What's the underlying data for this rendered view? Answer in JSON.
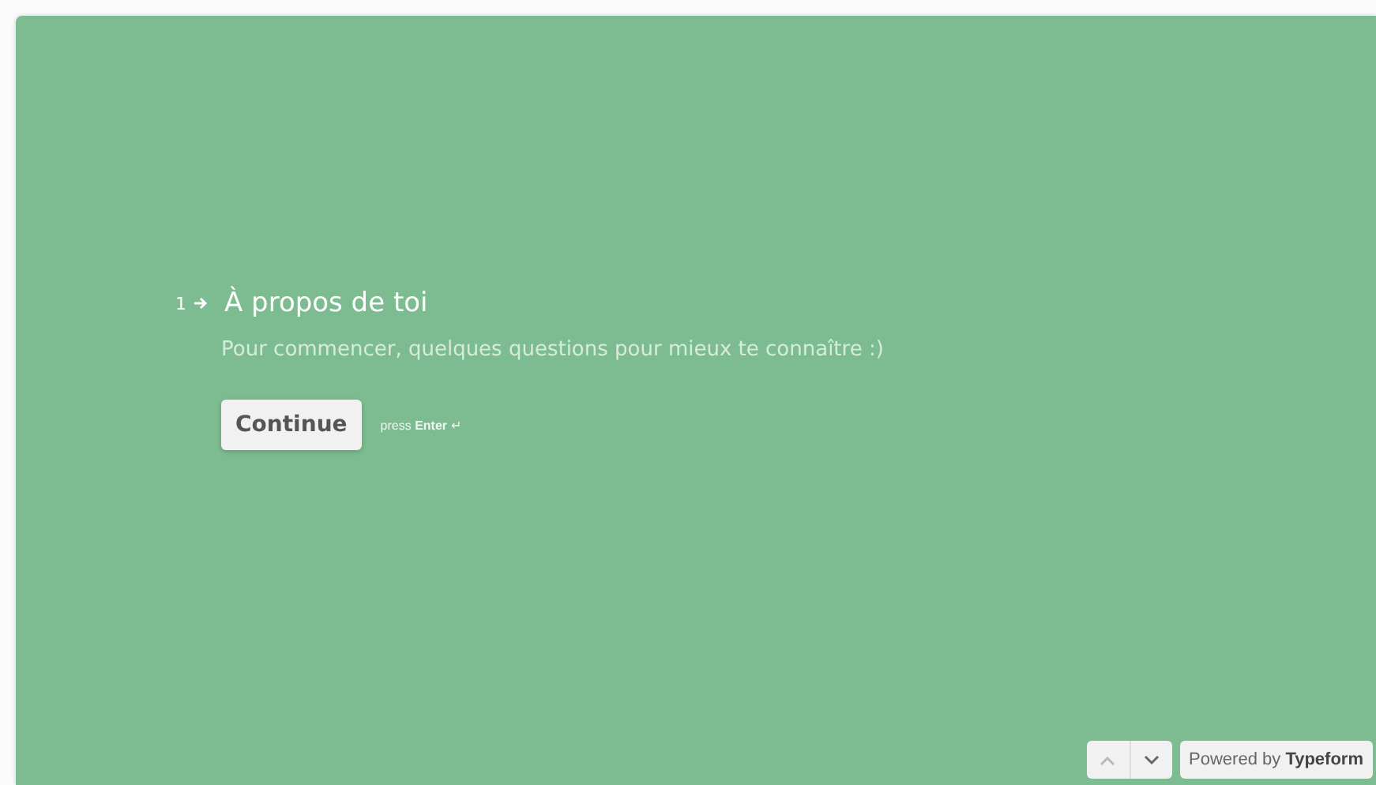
{
  "question": {
    "number": "1",
    "title": "À propos de toi",
    "description": "Pour commencer, quelques questions pour mieux te connaître :)"
  },
  "continue_button": {
    "label": "Continue",
    "hint": "press **Enter** ↵"
  },
  "navigation": [
    {
      "kind": "up",
      "disabled": true
    },
    {
      "kind": "down",
      "disabled": false
    }
  ],
  "branding": "Powered by **Typeform**"
}
